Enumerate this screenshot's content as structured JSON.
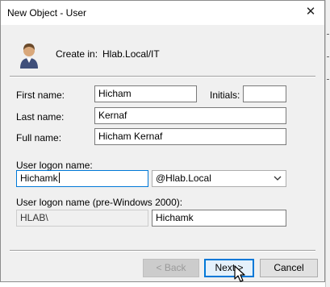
{
  "window": {
    "title": "New Object - User",
    "close_glyph": "✕"
  },
  "create_in": {
    "label": "Create in:",
    "value": "Hlab.Local/IT",
    "icon": "user-icon"
  },
  "fields": {
    "first_name": {
      "label": "First name:",
      "value": "Hicham"
    },
    "initials": {
      "label": "Initials:",
      "value": ""
    },
    "last_name": {
      "label": "Last name:",
      "value": "Kernaf"
    },
    "full_name": {
      "label": "Full name:",
      "value": "Hicham Kernaf"
    },
    "logon": {
      "label": "User logon name:",
      "value": "Hichamk",
      "domain": "@Hlab.Local"
    },
    "logon_pre2000": {
      "label": "User logon name (pre-Windows 2000):",
      "domain_prefix": "HLAB\\",
      "value": "Hichamk"
    }
  },
  "buttons": {
    "back": "< Back",
    "next": "Next >",
    "cancel": "Cancel"
  },
  "colors": {
    "accent": "#0078d7",
    "dialog_bg": "#f0f0f0"
  }
}
